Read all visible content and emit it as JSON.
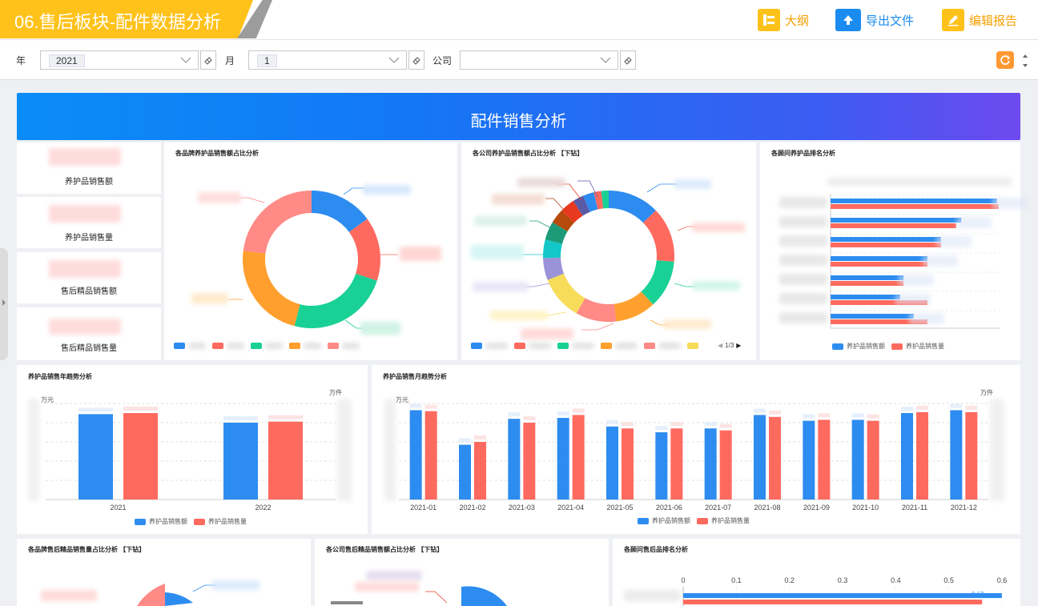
{
  "header": {
    "title": "06.售后板块-配件数据分析",
    "outline_label": "大纲",
    "export_label": "导出文件",
    "edit_label": "编辑报告"
  },
  "filters": {
    "year_label": "年",
    "year_value": "2021",
    "month_label": "月",
    "month_value": "1",
    "company_label": "公司",
    "company_value": ""
  },
  "banner": {
    "title": "配件销售分析"
  },
  "kpis": [
    {
      "label": "养护品销售额"
    },
    {
      "label": "养护品销售量"
    },
    {
      "label": "售后精品销售额"
    },
    {
      "label": "售后精品销售量"
    }
  ],
  "brand_pie": {
    "title": "各品牌养护品销售额占比分析"
  },
  "company_pie": {
    "title": "各公司养护品销售额占比分析 【下钻】",
    "pager": "1/3"
  },
  "consultant_rank": {
    "title": "各顾问养护品排名分析",
    "legend": [
      "养护品销售额",
      "养护品销售量"
    ]
  },
  "yearly": {
    "title": "养护品销售年趋势分析",
    "unit_left": "万元",
    "unit_right": "万件",
    "legend": [
      "养护品销售额",
      "养护品销售量"
    ]
  },
  "monthly": {
    "title": "养护品销售月趋势分析",
    "unit_left": "万元",
    "unit_right": "万件",
    "legend": [
      "养护品销售额",
      "养护品销售量"
    ]
  },
  "brand_boutique": {
    "title": "各品牌售后精品销售量占比分析 【下钻】"
  },
  "company_boutique": {
    "title": "各公司售后精品销售额占比分析 【下钻】"
  },
  "consultant_boutique": {
    "title": "各顾问售后品排名分析",
    "value_a": "0.63",
    "value_b": "0.58"
  },
  "colors": {
    "blue": "#2d8cf0",
    "red": "#ff6a5f",
    "green": "#19d195",
    "orange": "#ff9f2e",
    "salmon": "#ff8a86",
    "teal": "#14c8c8",
    "yellow": "#f7dc5a",
    "purple": "#9b93d8",
    "brown": "#b64a0d",
    "darkgreen": "#1d9a78"
  },
  "chart_data": [
    {
      "type": "pie",
      "title": "各品牌养护品销售额占比分析",
      "values": [
        15,
        15,
        24,
        23,
        23
      ],
      "colors": [
        "#2d8cf0",
        "#ff6a5f",
        "#19d195",
        "#ff9f2e",
        "#ff8a86"
      ]
    },
    {
      "type": "pie",
      "title": "各公司养护品销售额占比分析 【下钻】",
      "values": [
        14,
        15,
        13,
        11,
        11,
        12,
        6,
        5,
        5,
        4,
        4,
        3,
        3,
        2,
        2
      ],
      "colors": [
        "#2d8cf0",
        "#ff6a5f",
        "#19d195",
        "#ff9f2e",
        "#ff8a86",
        "#f7dc5a",
        "#9b93d8",
        "#14c8c8",
        "#1d9a78",
        "#b64a0d",
        "#e8391f",
        "#5a5ba8",
        "#2d8cf0",
        "#ff6a5f",
        "#19d195"
      ]
    },
    {
      "type": "bar",
      "title": "各顾问养护品排名分析",
      "orientation": "horizontal",
      "series": [
        {
          "name": "养护品销售额",
          "values": [
            0.98,
            0.77,
            0.65,
            0.57,
            0.43,
            0.41,
            0.49
          ]
        },
        {
          "name": "养护品销售量",
          "values": [
            0.99,
            0.74,
            0.65,
            0.57,
            0.43,
            0.57,
            0.57
          ]
        }
      ],
      "xlim": [
        0,
        1
      ]
    },
    {
      "type": "bar",
      "title": "养护品销售年趋势分析",
      "categories": [
        "2021",
        "2022"
      ],
      "series": [
        {
          "name": "养护品销售额",
          "values": [
            80,
            72
          ]
        },
        {
          "name": "养护品销售量",
          "values": [
            81,
            73
          ]
        }
      ],
      "ylim": [
        0,
        90
      ]
    },
    {
      "type": "bar",
      "title": "养护品销售月趋势分析",
      "categories": [
        "2021-01",
        "2021-02",
        "2021-03",
        "2021-04",
        "2021-05",
        "2021-06",
        "2021-07",
        "2021-08",
        "2021-09",
        "2021-10",
        "2021-11",
        "2021-12"
      ],
      "series": [
        {
          "name": "养护品销售额",
          "values": [
            93,
            57,
            84,
            85,
            76,
            70,
            74,
            88,
            82,
            83,
            90,
            93
          ]
        },
        {
          "name": "养护品销售量",
          "values": [
            92,
            60,
            80,
            88,
            74,
            74,
            72,
            86,
            83,
            82,
            91,
            91
          ]
        }
      ],
      "ylim": [
        0,
        100
      ]
    },
    {
      "type": "bar",
      "title": "各顾问售后品排名分析",
      "orientation": "horizontal",
      "ticks": [
        "0",
        "0.1",
        "0.2",
        "0.3",
        "0.4",
        "0.5",
        "0.6"
      ],
      "series": [
        {
          "name": "a",
          "values": [
            0.63
          ]
        },
        {
          "name": "b",
          "values": [
            0.58
          ]
        }
      ],
      "xlim": [
        0,
        0.6
      ]
    }
  ]
}
